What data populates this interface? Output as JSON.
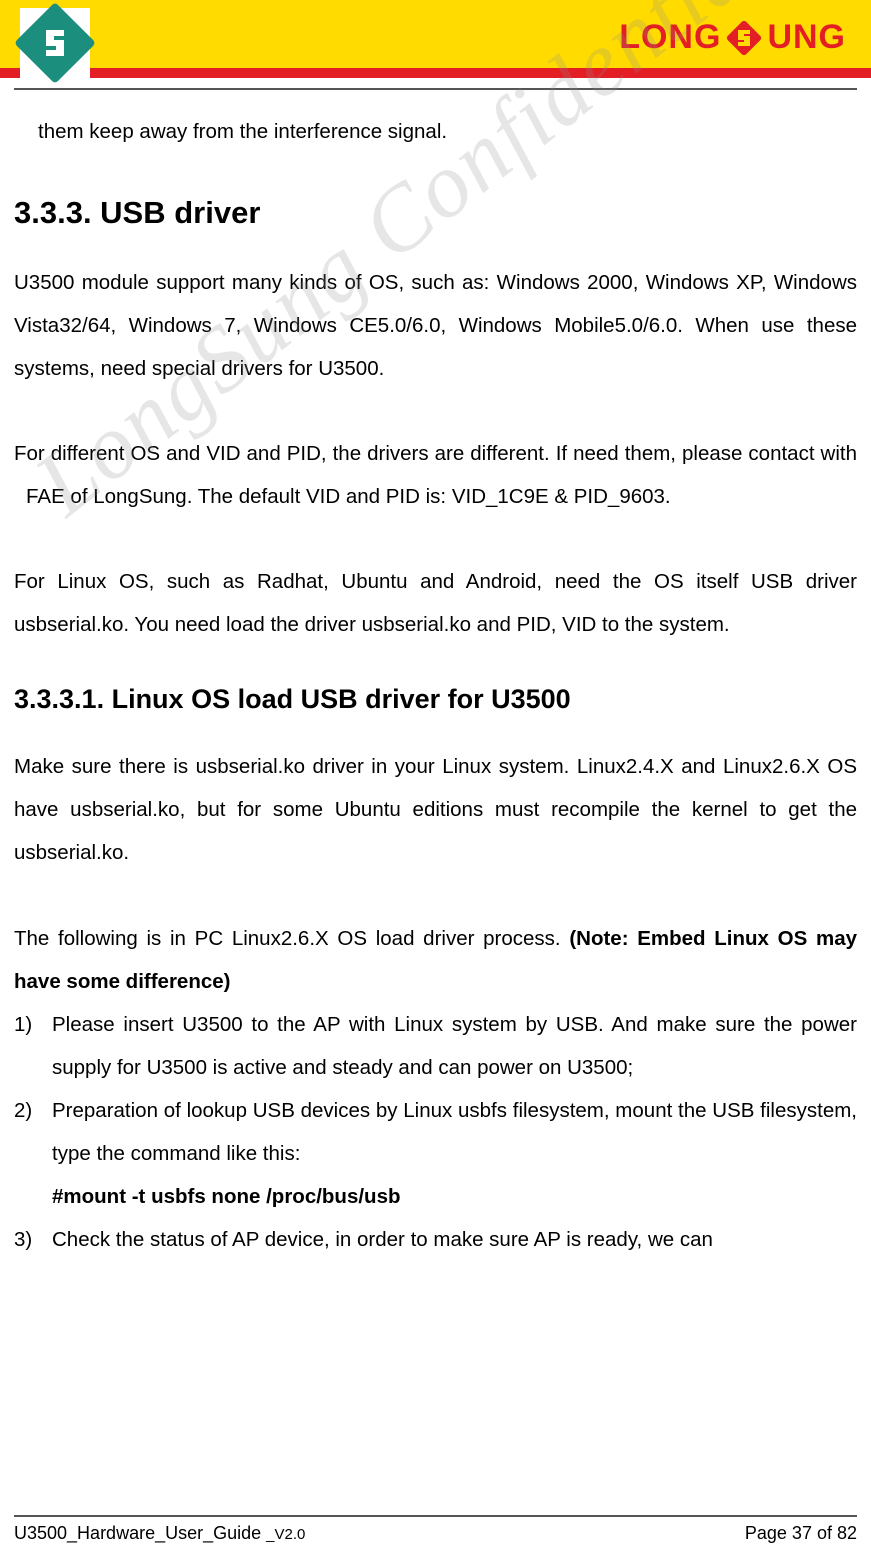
{
  "brand": {
    "part1": "LONG",
    "part2": "UNG"
  },
  "watermark": "LongSung Confidential",
  "intro_fragment": "them keep away from the interference signal.",
  "section_333": {
    "heading": "3.3.3. USB driver",
    "p1": "U3500 module support many kinds of OS, such as: Windows 2000, Windows XP, Windows Vista32/64, Windows 7, Windows CE5.0/6.0, Windows Mobile5.0/6.0. When use these systems, need special drivers for U3500.",
    "p2": "For different OS and VID and PID, the drivers are different. If need them, please contact with FAE of LongSung. The default VID and PID is: VID_1C9E & PID_9603.",
    "p3": "For Linux OS, such as Radhat, Ubuntu and Android, need the OS itself USB driver usbserial.ko. You need load the driver usbserial.ko and PID, VID to the system."
  },
  "section_3331": {
    "heading": "3.3.3.1. Linux OS load USB driver for U3500",
    "p1": "Make sure there is usbserial.ko driver in your Linux system. Linux2.4.X and Linux2.6.X OS have usbserial.ko, but for some Ubuntu editions must recompile the kernel to get the usbserial.ko.",
    "p2_a": "The following is in PC Linux2.6.X OS load driver process. ",
    "p2_b": "(Note: Embed Linux OS may have some difference)",
    "list": {
      "n1": "1)",
      "t1": "Please insert U3500 to the AP with Linux system by USB. And make sure the power supply for U3500 is active and steady and can power on U3500;",
      "n2": "2)",
      "t2": "Preparation of lookup USB devices by Linux usbfs filesystem, mount the USB filesystem, type the command like this:",
      "cmd2": "#mount -t usbfs none /proc/bus/usb",
      "n3": "3)",
      "t3": "Check the status of AP device, in order to make sure AP is ready, we can"
    }
  },
  "footer": {
    "doc": "U3500_Hardware_User_Guide ",
    "ver": "_V2.0",
    "page": "Page 37 of 82"
  }
}
